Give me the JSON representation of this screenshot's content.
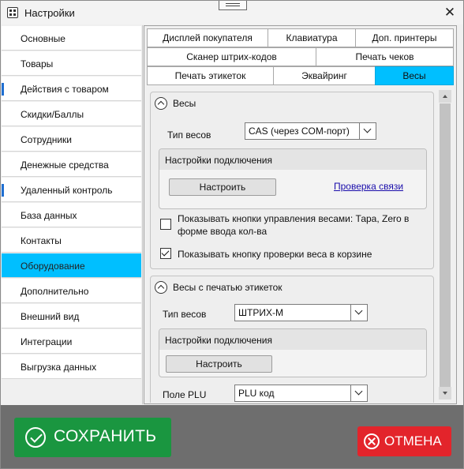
{
  "window": {
    "title": "Настройки"
  },
  "sidebar": {
    "items": [
      {
        "label": "Основные"
      },
      {
        "label": "Товары"
      },
      {
        "label": "Действия с товаром"
      },
      {
        "label": "Скидки/Баллы"
      },
      {
        "label": "Сотрудники"
      },
      {
        "label": "Денежные средства"
      },
      {
        "label": "Удаленный контроль"
      },
      {
        "label": "База данных"
      },
      {
        "label": "Контакты"
      },
      {
        "label": "Оборудование"
      },
      {
        "label": "Дополнительно"
      },
      {
        "label": "Внешний вид"
      },
      {
        "label": "Интеграции"
      },
      {
        "label": "Выгрузка данных"
      }
    ],
    "active": "Оборудование"
  },
  "tabs": {
    "row1": [
      "Дисплей покупателя",
      "Клавиатура",
      "Доп. принтеры"
    ],
    "row2": [
      "Сканер штрих-кодов",
      "Печать чеков"
    ],
    "row3": [
      "Печать этикеток",
      "Эквайринг",
      "Весы"
    ],
    "active": "Весы"
  },
  "scales": {
    "title": "Весы",
    "type_label": "Тип весов",
    "type_value": "CAS (через COM-порт)",
    "connection_title": "Настройки подключения",
    "configure_label": "Настроить",
    "check_link": "Проверка связи",
    "option1_label": "Показывать кнопки управления весами: Тара, Zero в форме ввода кол-ва",
    "option1_checked": false,
    "option2_label": "Показывать кнопку проверки веса в корзине",
    "option2_checked": true
  },
  "label_scales": {
    "title": "Весы с печатью этикеток",
    "type_label": "Тип весов",
    "type_value": "ШТРИХ-М",
    "connection_title": "Настройки подключения",
    "configure_label": "Настроить",
    "plu_label": "Поле PLU",
    "plu_value": "PLU код"
  },
  "footer": {
    "save_label": "СОХРАНИТЬ",
    "cancel_label": "ОТМЕНА"
  },
  "colors": {
    "accent": "#00bfff",
    "save": "#1a9640",
    "cancel": "#e3242b",
    "footer": "#6e6e6e"
  }
}
